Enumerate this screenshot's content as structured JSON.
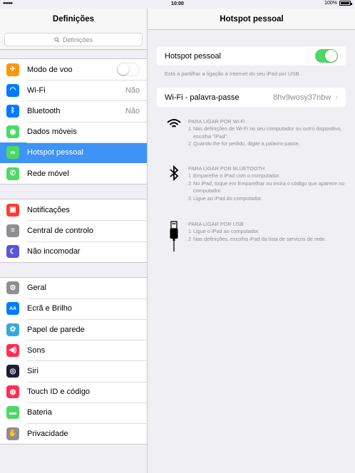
{
  "status": {
    "time": "10:00",
    "battery": "100%",
    "signal": "●●●●●"
  },
  "left": {
    "title": "Definições",
    "search_placeholder": "Definições",
    "groups": [
      [
        {
          "label": "Modo de voo",
          "icon": "airplane-icon",
          "color": "#ff9500",
          "glyph": "✈",
          "value": "",
          "toggle": "off"
        },
        {
          "label": "Wi-Fi",
          "icon": "wifi-icon",
          "color": "#007aff",
          "glyph": "◠",
          "value": "Não"
        },
        {
          "label": "Bluetooth",
          "icon": "bluetooth-icon",
          "color": "#007aff",
          "glyph": "ᛒ",
          "value": "Não"
        },
        {
          "label": "Dados móveis",
          "icon": "antenna-icon",
          "color": "#4cd964",
          "glyph": "◉",
          "value": ""
        },
        {
          "label": "Hotspot pessoal",
          "icon": "hotspot-icon",
          "color": "#4cd964",
          "glyph": "∞",
          "value": "",
          "selected": true
        },
        {
          "label": "Rede móvel",
          "icon": "phone-icon",
          "color": "#4cd964",
          "glyph": "✆",
          "value": ""
        }
      ],
      [
        {
          "label": "Notificações",
          "icon": "notifications-icon",
          "color": "#ff3b30",
          "glyph": "▣"
        },
        {
          "label": "Central de controlo",
          "icon": "control-center-icon",
          "color": "#8e8e93",
          "glyph": "≡"
        },
        {
          "label": "Não incomodar",
          "icon": "moon-icon",
          "color": "#5856d6",
          "glyph": "☾"
        }
      ],
      [
        {
          "label": "Geral",
          "icon": "gear-icon",
          "color": "#8e8e93",
          "glyph": "⚙"
        },
        {
          "label": "Ecrã e Brilho",
          "icon": "display-icon",
          "color": "#007aff",
          "glyph": "AA"
        },
        {
          "label": "Papel de parede",
          "icon": "wallpaper-icon",
          "color": "#34aadc",
          "glyph": "✿"
        },
        {
          "label": "Sons",
          "icon": "speaker-icon",
          "color": "#ff2d55",
          "glyph": "◀)"
        },
        {
          "label": "Siri",
          "icon": "siri-icon",
          "color": "#1c1c3a",
          "glyph": "◎"
        },
        {
          "label": "Touch ID e código",
          "icon": "fingerprint-icon",
          "color": "#ff2d55",
          "glyph": "◍"
        },
        {
          "label": "Bateria",
          "icon": "battery-icon",
          "color": "#4cd964",
          "glyph": "▬"
        },
        {
          "label": "Privacidade",
          "icon": "hand-icon",
          "color": "#8e8e93",
          "glyph": "✋"
        }
      ]
    ]
  },
  "right": {
    "title": "Hotspot pessoal",
    "hotspot_label": "Hotspot pessoal",
    "hotspot_toggle": "on",
    "note": "Está a partilhar a ligação à Internet do seu iPad por USB.",
    "wifi_label": "Wi-Fi - palavra-passe",
    "wifi_password": "8hv9wosy37nbw",
    "instructions": [
      {
        "icon": "wifi-icon",
        "heading": "PARA LIGAR POR Wi-Fi",
        "steps": [
          "Nas definições de Wi-Fi no seu computador ou outro dispositivo, escolha \"iPad\".",
          "Quando lhe for pedido, digite a palavra-passe."
        ]
      },
      {
        "icon": "bluetooth-icon",
        "heading": "PARA LIGAR POR BLUETOOTH",
        "steps": [
          "Emparelhe o iPad com o computador.",
          "No iPad, toque em Emparelhar ou insira o código que aparece no computador.",
          "Ligue ao iPad do computador."
        ]
      },
      {
        "icon": "usb-icon",
        "heading": "PARA LIGAR POR USB",
        "steps": [
          "Ligue o iPad ao computador.",
          "Nas definições, escolha iPad da lista de serviços de rede."
        ]
      }
    ]
  }
}
